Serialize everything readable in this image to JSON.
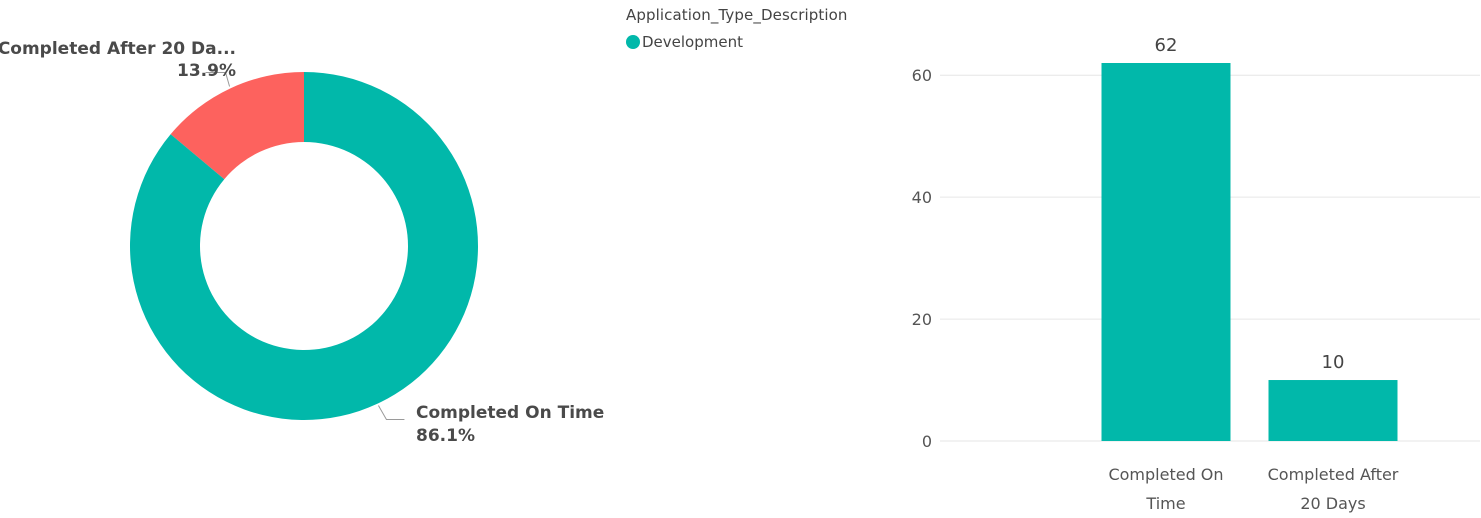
{
  "legend": {
    "title": "Application_Type_Description",
    "items": [
      {
        "label": "Development",
        "color": "#01B8AA"
      }
    ]
  },
  "chart_data": [
    {
      "type": "pie",
      "variant": "donut",
      "slices": [
        {
          "label": "Completed After 20 Da...",
          "value": 13.9,
          "value_label": "13.9%",
          "color": "#FD625E"
        },
        {
          "label": "Completed On Time",
          "value": 86.1,
          "value_label": "86.1%",
          "color": "#01B8AA"
        }
      ]
    },
    {
      "type": "bar",
      "categories": [
        [
          "Completed On",
          "Time"
        ],
        [
          "Completed After",
          "20 Days"
        ]
      ],
      "values": [
        62,
        10
      ],
      "data_labels": [
        "62",
        "10"
      ],
      "color": "#01B8AA",
      "ylim": [
        0,
        62
      ],
      "yticks": [
        0,
        20,
        40,
        60
      ],
      "grid": true
    }
  ]
}
